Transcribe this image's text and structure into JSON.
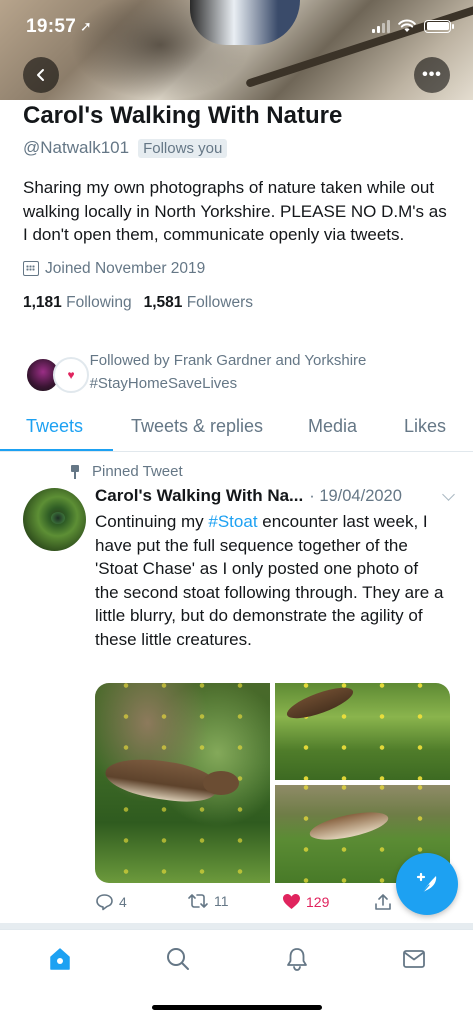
{
  "status_bar": {
    "time": "19:57",
    "location_icon": "location-arrow-icon",
    "signal_icon": "cellular-signal-icon",
    "wifi_icon": "wifi-icon",
    "battery_icon": "battery-icon"
  },
  "header": {
    "back_icon": "back-arrow-icon",
    "more_label": "•••"
  },
  "profile": {
    "name": "Carol's Walking With Nature",
    "handle": "@Natwalk101",
    "follows_you": "Follows you",
    "bio": "Sharing my own photographs of nature taken while out walking locally in North Yorkshire. PLEASE NO D.M's as I don't open them, communicate openly via tweets.",
    "joined": "Joined November 2019",
    "following_count": "1,181",
    "following_label": "Following",
    "followers_count": "1,581",
    "followers_label": "Followers",
    "followed_by": "Followed by Frank Gardner and Yorkshire #StayHomeSaveLives"
  },
  "tabs": [
    {
      "label": "Tweets",
      "active": true
    },
    {
      "label": "Tweets & replies",
      "active": false
    },
    {
      "label": "Media",
      "active": false
    },
    {
      "label": "Likes",
      "active": false
    }
  ],
  "tweet": {
    "pinned_label": "Pinned Tweet",
    "author": "Carol's Walking With Na...",
    "date": "· 19/04/2020",
    "text_before": "Continuing my ",
    "hashtag": "#Stoat",
    "text_after": " encounter last week, I have put the full sequence together of the 'Stoat Chase' as I only posted one photo of the second stoat following through. They are a little blurry, but do demonstrate the agility of these little creatures.",
    "replies": "4",
    "retweets": "11",
    "likes": "129"
  },
  "colors": {
    "accent": "#1da1f2",
    "like": "#e0245e",
    "muted": "#657786",
    "text": "#14171a"
  },
  "bottom_nav": [
    "home-icon",
    "search-icon",
    "notifications-bell-icon",
    "messages-envelope-icon"
  ]
}
